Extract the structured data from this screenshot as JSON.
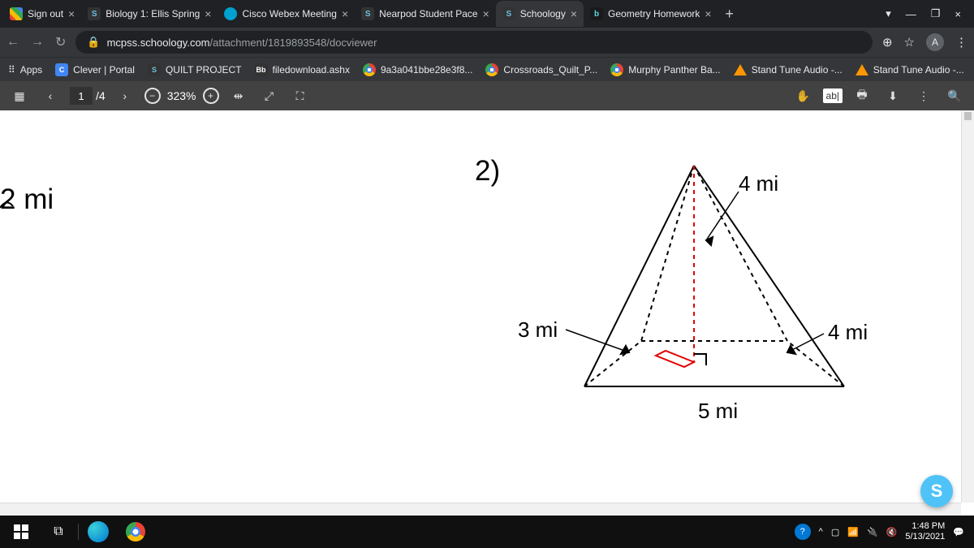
{
  "tabs": [
    {
      "title": "Sign out",
      "icon": "multi"
    },
    {
      "title": "Biology 1: Ellis Spring",
      "icon": "s"
    },
    {
      "title": "Cisco Webex Meeting",
      "icon": "webex"
    },
    {
      "title": "Nearpod Student Pace",
      "icon": "s"
    },
    {
      "title": "Schoology",
      "icon": "s",
      "active": true
    },
    {
      "title": "Geometry Homework",
      "icon": "b"
    }
  ],
  "url": {
    "host": "mcpss.schoology.com",
    "path": "/attachment/1819893548/docviewer"
  },
  "bookmarks": [
    {
      "icon": "apps",
      "label": "Apps"
    },
    {
      "icon": "c",
      "label": "Clever | Portal"
    },
    {
      "icon": "s",
      "label": "QUILT PROJECT"
    },
    {
      "icon": "bb",
      "label": "filedownload.ashx"
    },
    {
      "icon": "chrome",
      "label": "9a3a041bbe28e3f8..."
    },
    {
      "icon": "chrome",
      "label": "Crossroads_Quilt_P..."
    },
    {
      "icon": "chrome",
      "label": "Murphy Panther Ba..."
    },
    {
      "icon": "tri",
      "label": "Stand Tune Audio -..."
    },
    {
      "icon": "tri",
      "label": "Stand Tune Audio -..."
    }
  ],
  "viewer": {
    "page": "1",
    "total": "/4",
    "zoom": "323%",
    "ab": "ab|"
  },
  "doc": {
    "problem": "2)",
    "left_label": "2 mi",
    "dims": {
      "slant": "4 mi",
      "base_depth": "3 mi",
      "base_width": "5 mi",
      "edge": "4 mi"
    }
  },
  "sys": {
    "time": "1:48 PM",
    "date": "5/13/2021"
  },
  "profile": "A"
}
